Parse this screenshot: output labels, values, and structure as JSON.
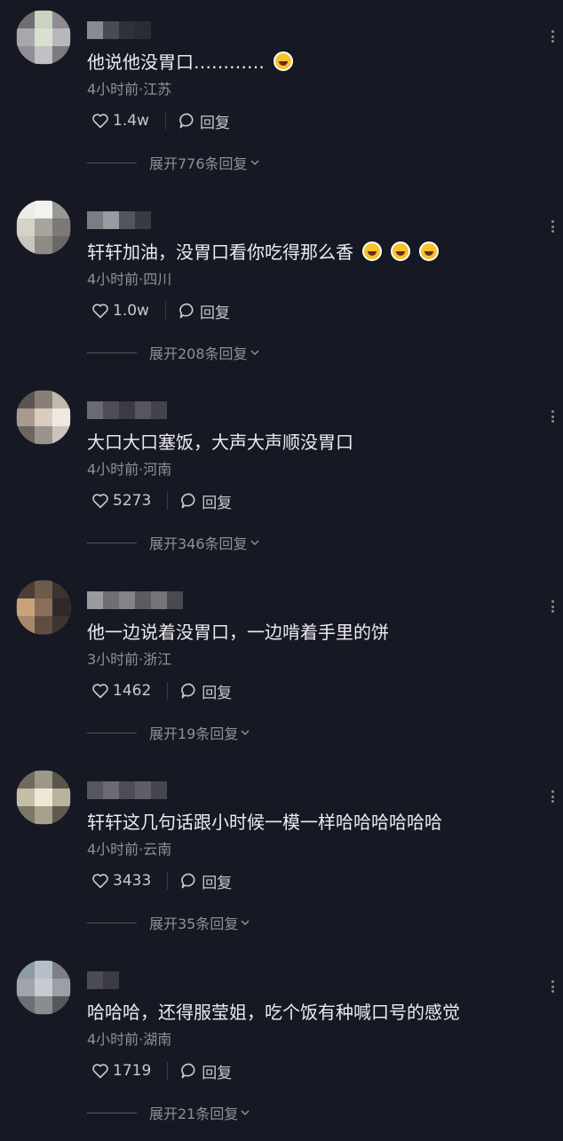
{
  "reply_label": "回复",
  "comments": [
    {
      "text": "他说他没胃口…………",
      "emoji_count": 1,
      "meta": "4小时前·江苏",
      "likes": "1.4w",
      "expand": "展开776条回复"
    },
    {
      "text": "轩轩加油，没胃口看你吃得那么香",
      "emoji_count": 3,
      "meta": "4小时前·四川",
      "likes": "1.0w",
      "expand": "展开208条回复"
    },
    {
      "text": "大口大口塞饭，大声大声顺没胃口",
      "emoji_count": 0,
      "meta": "4小时前·河南",
      "likes": "5273",
      "expand": "展开346条回复"
    },
    {
      "text": "他一边说着没胃口，一边啃着手里的饼",
      "emoji_count": 0,
      "meta": "3小时前·浙江",
      "likes": "1462",
      "expand": "展开19条回复"
    },
    {
      "text": "轩轩这几句话跟小时候一模一样哈哈哈哈哈哈",
      "emoji_count": 0,
      "meta": "4小时前·云南",
      "likes": "3433",
      "expand": "展开35条回复"
    },
    {
      "text": "哈哈哈，还得服莹姐，吃个饭有种喊口号的感觉",
      "emoji_count": 0,
      "meta": "4小时前·湖南",
      "likes": "1719",
      "expand": "展开21条回复"
    }
  ],
  "colors": {
    "background": "#161823",
    "text": "#ececee",
    "secondary": "#8f9097"
  }
}
